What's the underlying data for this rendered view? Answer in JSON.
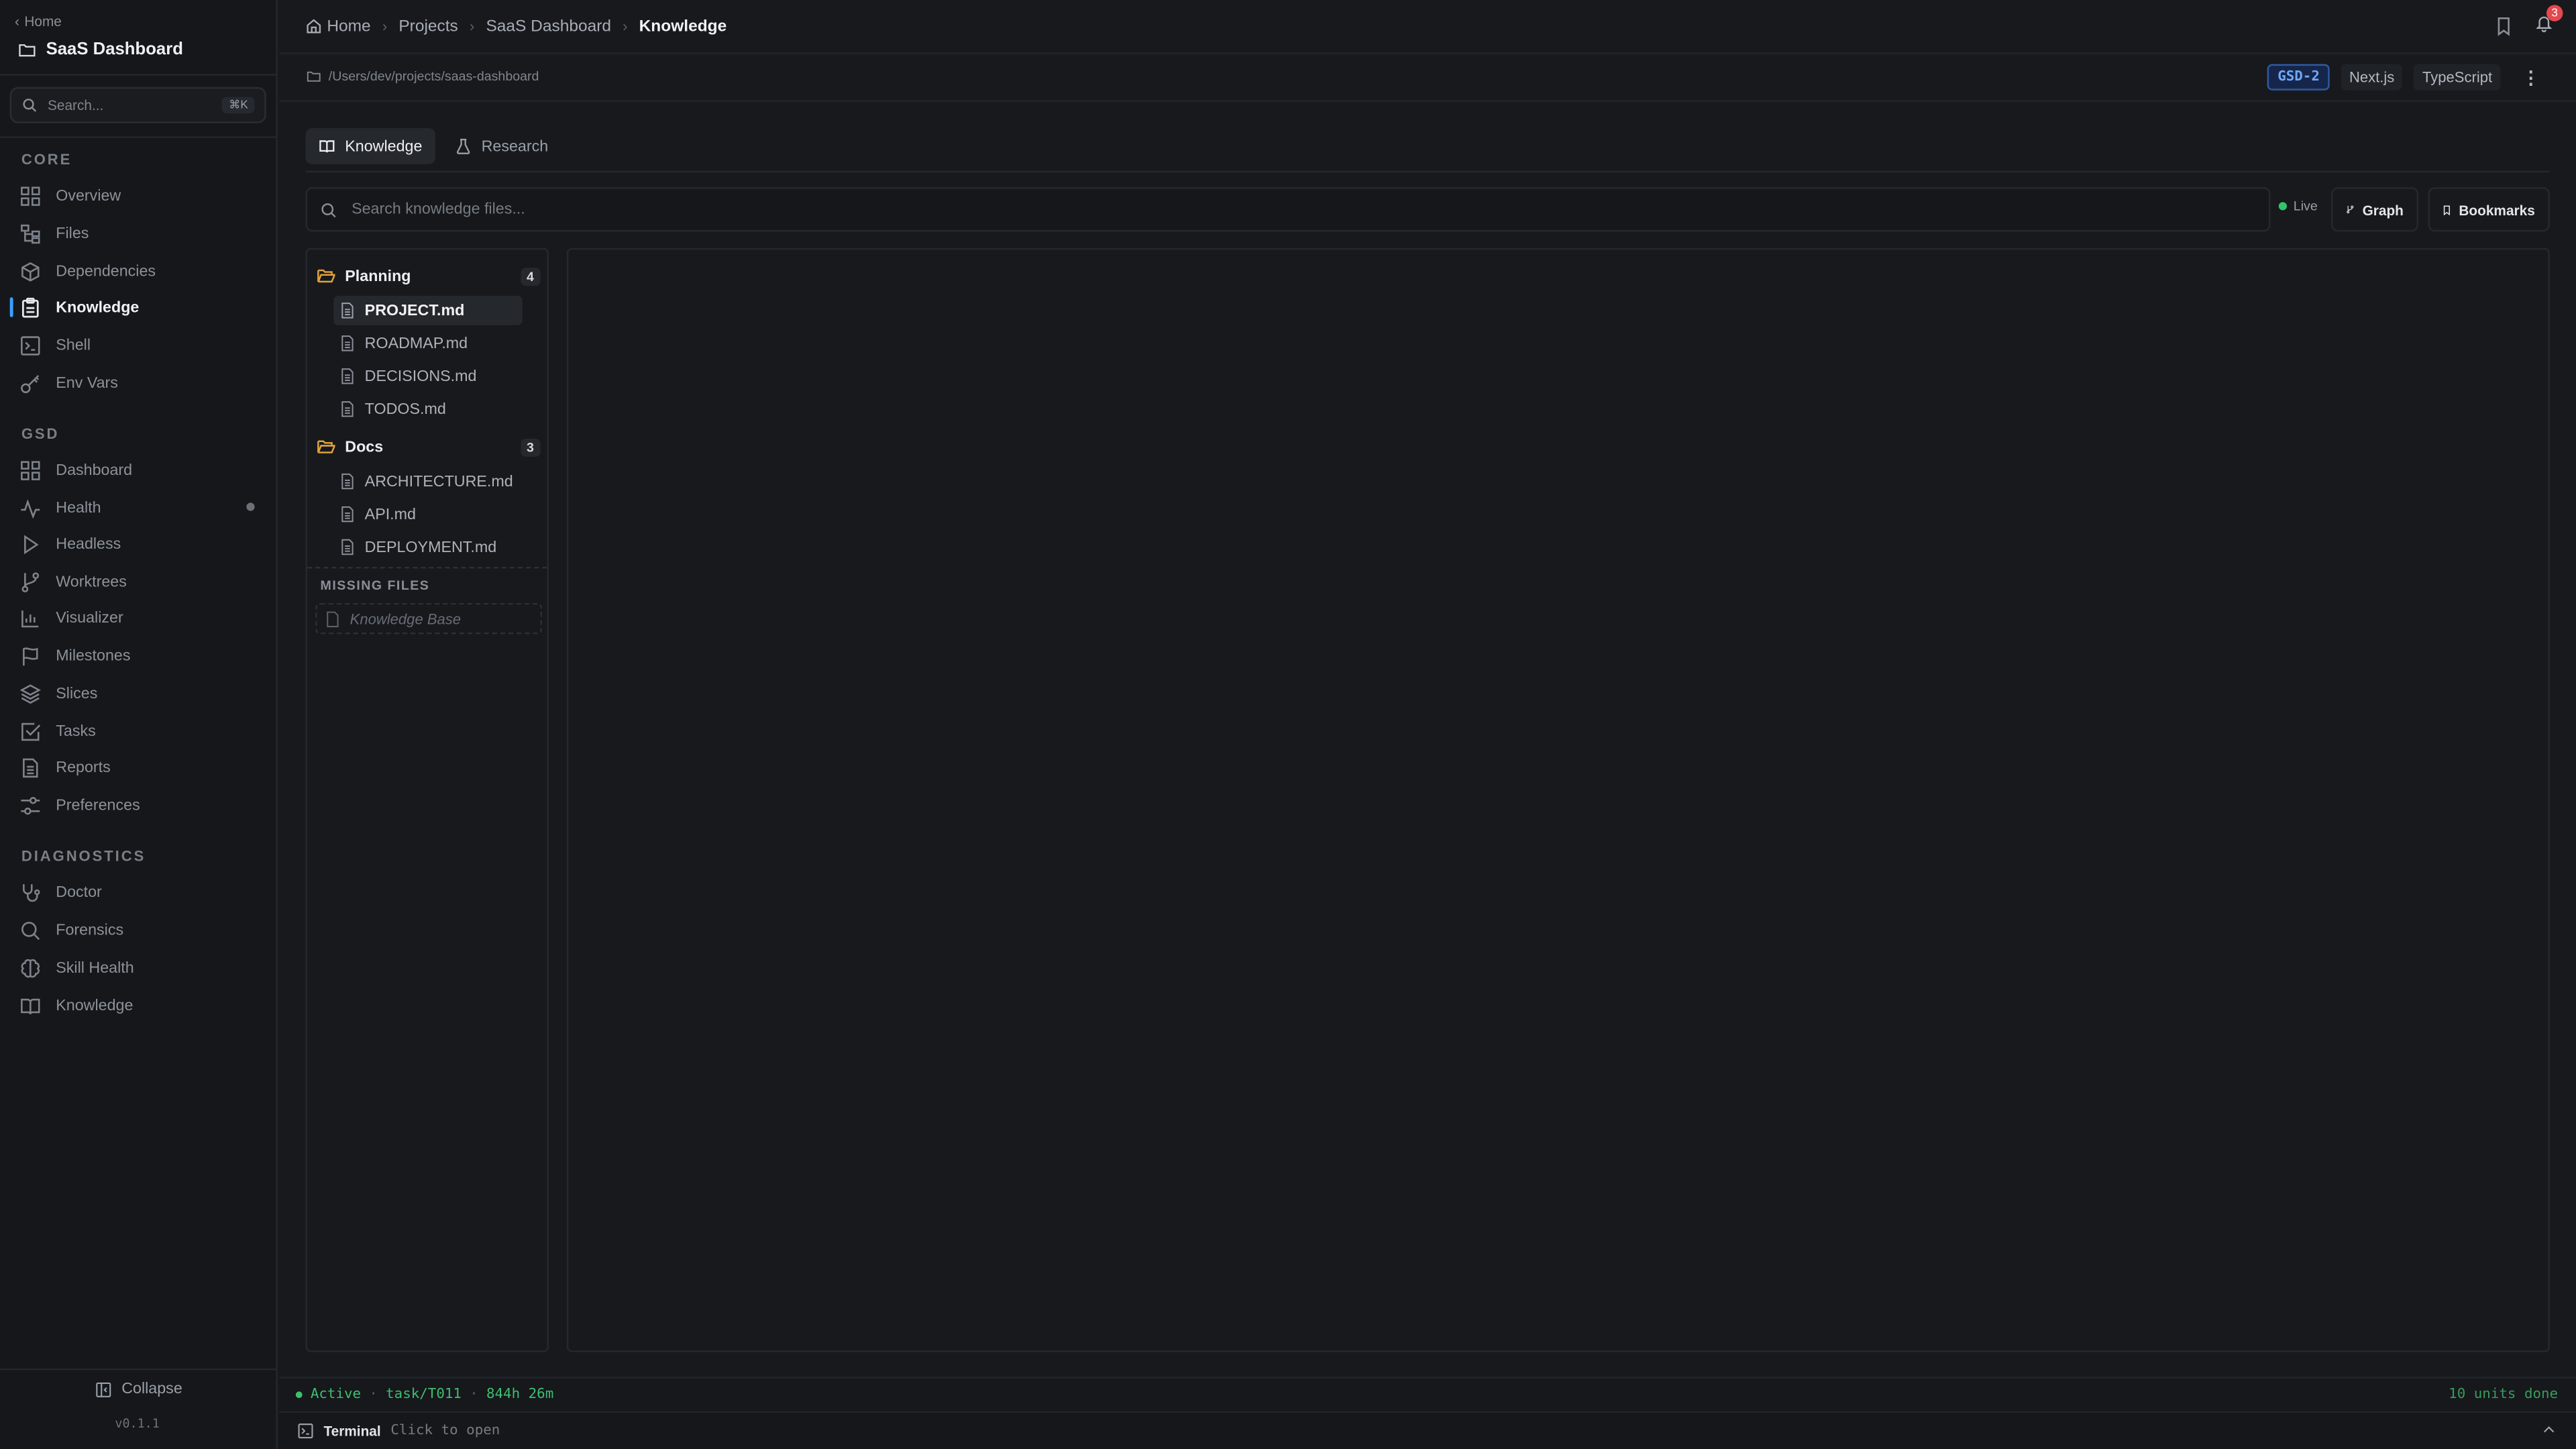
{
  "sidebar": {
    "back_label": "Home",
    "project_title": "SaaS Dashboard",
    "search_placeholder": "Search...",
    "search_shortcut": "⌘K",
    "sections": [
      {
        "label": "CORE",
        "items": [
          {
            "label": "Overview",
            "icon": "grid-icon"
          },
          {
            "label": "Files",
            "icon": "file-tree-icon"
          },
          {
            "label": "Dependencies",
            "icon": "package-icon"
          },
          {
            "label": "Knowledge",
            "icon": "clipboard-icon",
            "active": true
          },
          {
            "label": "Shell",
            "icon": "terminal-icon"
          },
          {
            "label": "Env Vars",
            "icon": "key-icon"
          }
        ]
      },
      {
        "label": "GSD",
        "items": [
          {
            "label": "Dashboard",
            "icon": "grid-icon"
          },
          {
            "label": "Health",
            "icon": "activity-icon"
          },
          {
            "label": "Headless",
            "icon": "play-icon"
          },
          {
            "label": "Worktrees",
            "icon": "git-branch-icon"
          },
          {
            "label": "Visualizer",
            "icon": "bar-chart-icon"
          },
          {
            "label": "Milestones",
            "icon": "flag-icon"
          },
          {
            "label": "Slices",
            "icon": "layers-icon"
          },
          {
            "label": "Tasks",
            "icon": "check-square-icon"
          },
          {
            "label": "Reports",
            "icon": "document-icon"
          },
          {
            "label": "Preferences",
            "icon": "sliders-icon"
          }
        ]
      },
      {
        "label": "DIAGNOSTICS",
        "items": [
          {
            "label": "Doctor",
            "icon": "stethoscope-icon"
          },
          {
            "label": "Forensics",
            "icon": "search-icon"
          },
          {
            "label": "Skill Health",
            "icon": "brain-icon"
          },
          {
            "label": "Knowledge",
            "icon": "book-icon"
          }
        ]
      }
    ],
    "collapse_label": "Collapse",
    "version": "v0.1.1"
  },
  "breadcrumb": [
    "Home",
    "Projects",
    "SaaS Dashboard",
    "Knowledge"
  ],
  "notifications_count": "3",
  "path": "/Users/dev/projects/saas-dashboard",
  "chips": {
    "gsd": "GSD-2",
    "framework": "Next.js",
    "language": "TypeScript"
  },
  "tabs": [
    {
      "label": "Knowledge",
      "active": true
    },
    {
      "label": "Research",
      "active": false
    }
  ],
  "search": {
    "placeholder": "Search knowledge files..."
  },
  "live_label": "Live",
  "graph_label": "Graph",
  "bookmarks_label": "Bookmarks",
  "tree": {
    "folders": [
      {
        "name": "Planning",
        "count": "4",
        "files": [
          "PROJECT.md",
          "ROADMAP.md",
          "DECISIONS.md",
          "TODOS.md"
        ]
      },
      {
        "name": "Docs",
        "count": "3",
        "files": [
          "ARCHITECTURE.md",
          "API.md",
          "DEPLOYMENT.md"
        ]
      }
    ],
    "missing_label": "MISSING FILES",
    "missing_items": [
      "Knowledge Base"
    ]
  },
  "status": {
    "state": "Active",
    "task": "task/T011",
    "elapsed": "844h 26m",
    "units": "10 units done"
  },
  "terminal": {
    "label": "Terminal",
    "hint": "Click to open"
  },
  "colors": {
    "accent": "#3aa0ff",
    "success": "#3fbf6d",
    "folder": "#e0a23a",
    "notif": "#e5484d"
  }
}
